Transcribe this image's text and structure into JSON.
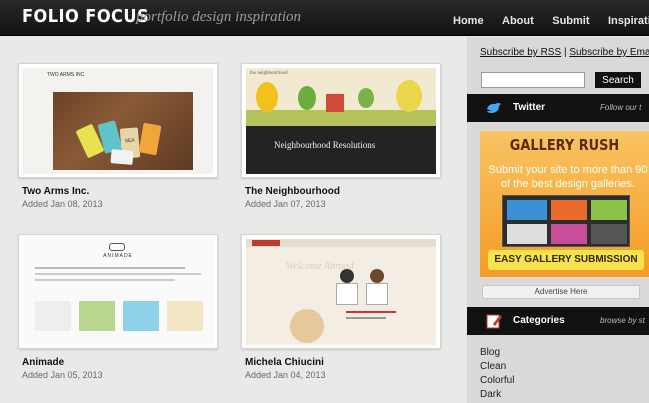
{
  "header": {
    "logo": "FOLIO FOCUS",
    "tagline": "portfolio design inspiration",
    "nav": [
      "Home",
      "About",
      "Submit",
      "Inspiration Fu"
    ]
  },
  "cards": [
    {
      "title": "Two Arms Inc.",
      "date": "Added Jan 08, 2013",
      "thumb_header": "TWO ARMS INC.",
      "thumb_tag_text": "SEA"
    },
    {
      "title": "The Neighbourhood",
      "date": "Added Jan 07, 2013",
      "thumb_header": "the neighbourhood",
      "thumb_caption": "Neighbourhood Resolutions"
    },
    {
      "title": "Animade",
      "date": "Added Jan 05, 2013",
      "thumb_header": "ANIMADE"
    },
    {
      "title": "Michela Chiucini",
      "date": "Added Jan 04, 2013",
      "thumb_header": "Welcome Abroad"
    }
  ],
  "sidebar": {
    "subscribe_rss": "Subscribe by RSS",
    "separator": "|",
    "subscribe_email": "Subscribe by Email",
    "search_placeholder": "",
    "search_button": "Search",
    "twitter_label": "Twitter",
    "twitter_side": "Follow our t",
    "ad_heading": "GALLERY RUSH",
    "ad_text": "Submit your site to more than 90 of the best design galleries.",
    "ad_cta": "EASY GALLERY SUBMISSION",
    "advertise": "Advertise Here",
    "categories_label": "Categories",
    "categories_side": "browse by st",
    "categories": [
      "Blog",
      "Clean",
      "Colorful",
      "Dark"
    ]
  },
  "colors": {
    "header_bg": "#111111",
    "sidebar_bg": "#d9d9d7",
    "main_bg": "#e9e9e7",
    "ad_orange": "#f49b25"
  }
}
